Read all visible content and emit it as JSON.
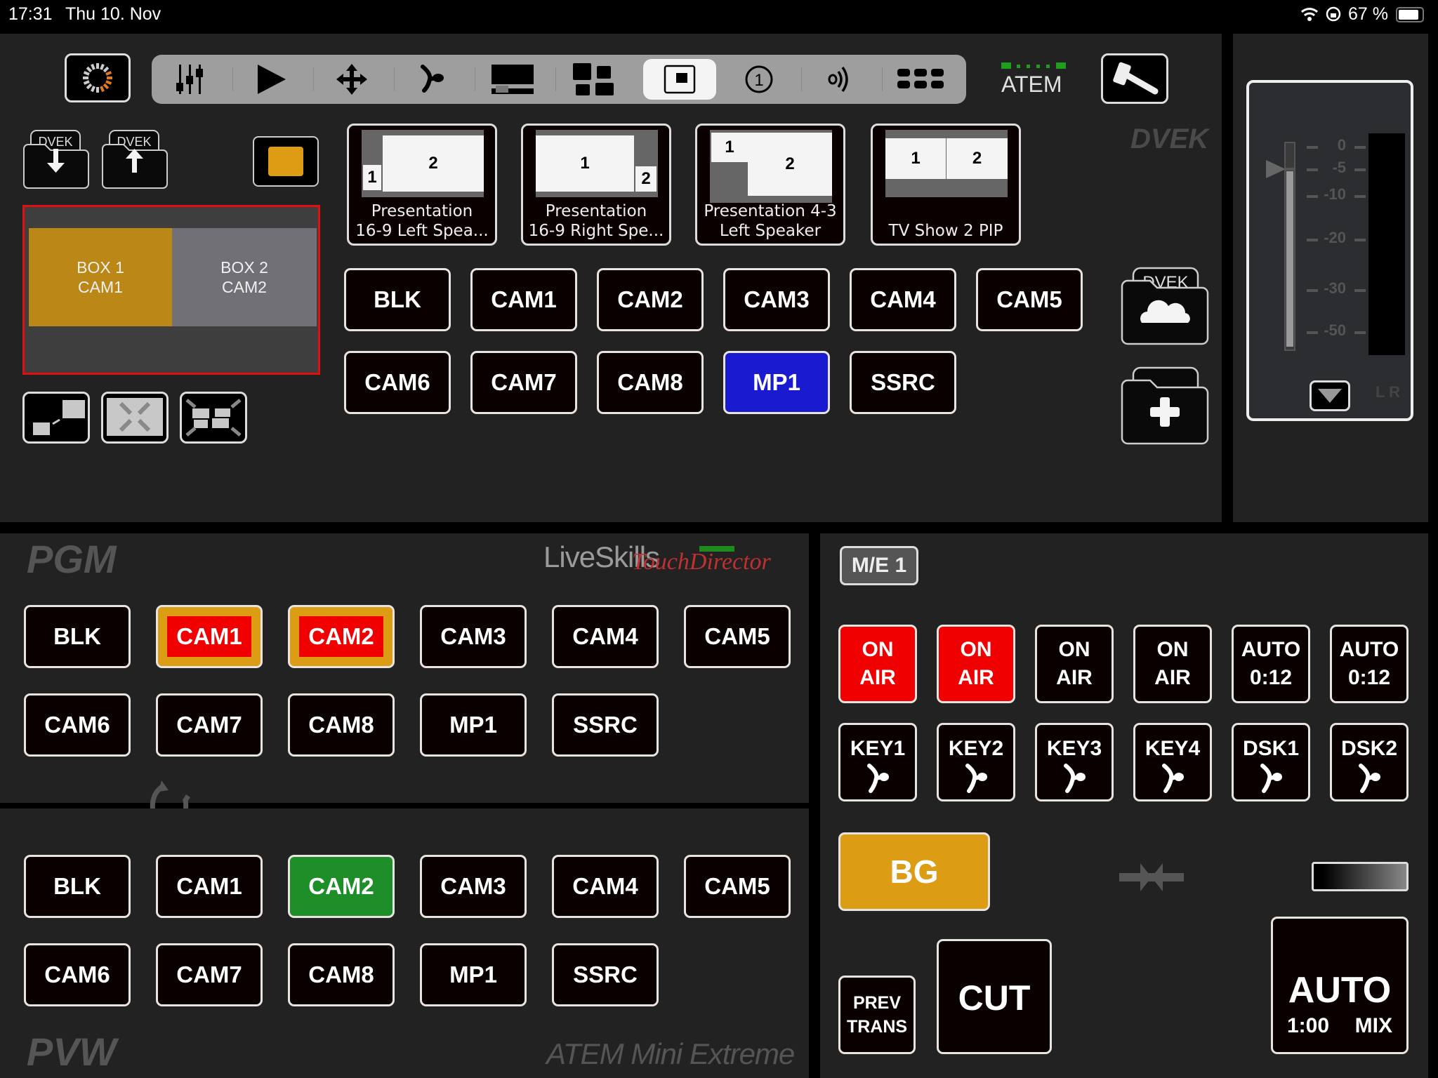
{
  "status_bar": {
    "time": "17:31",
    "date": "Thu 10. Nov",
    "battery": "67 %"
  },
  "toolbar": {
    "items": [
      "mixer-icon",
      "play-icon",
      "move-icon",
      "transition-icon",
      "lower-third-icon",
      "multiview-icon",
      "dvek-icon",
      "number-one-icon",
      "audio-icon",
      "more-icon"
    ],
    "active_index": 6
  },
  "atem": {
    "label": "ATEM",
    "connected_color": "#1e9e1e"
  },
  "dvek": {
    "title": "DVEK",
    "folder_tab_label": "DVEK",
    "box1": {
      "line1": "BOX 1",
      "line2": "CAM1",
      "color": "#bb8818"
    },
    "box2": {
      "line1": "BOX 2",
      "line2": "CAM2",
      "color": "#707076"
    },
    "color_swatch": "#dd9c14",
    "presets": [
      {
        "line1": "Presentation",
        "line2": "16-9 Left Spea...",
        "n1": "1",
        "n2": "2"
      },
      {
        "line1": "Presentation",
        "line2": "16-9 Right Spe...",
        "n1": "1",
        "n2": "2"
      },
      {
        "line1": "Presentation 4-3",
        "line2": "Left Speaker",
        "n1": "1",
        "n2": "2"
      },
      {
        "line1": "",
        "line2": "TV Show 2 PIP",
        "n1": "1",
        "n2": "2"
      }
    ],
    "sources": [
      "BLK",
      "CAM1",
      "CAM2",
      "CAM3",
      "CAM4",
      "CAM5",
      "CAM6",
      "CAM7",
      "CAM8",
      "MP1",
      "SSRC"
    ],
    "selected_source": "MP1",
    "selected_color": "#1a1ad0"
  },
  "audio": {
    "scale": [
      "0",
      "-5",
      "-10",
      "-20",
      "-30",
      "-50"
    ],
    "fader_db": -5,
    "channels": "L R"
  },
  "pgm": {
    "title": "PGM",
    "brand1": "LiveSkills",
    "brand2": "TouchDirector",
    "sources": [
      "BLK",
      "CAM1",
      "CAM2",
      "CAM3",
      "CAM4",
      "CAM5",
      "CAM6",
      "CAM7",
      "CAM8",
      "MP1",
      "SSRC"
    ],
    "on_air": [
      "CAM1",
      "CAM2"
    ]
  },
  "pvw": {
    "title": "PVW",
    "model": "ATEM Mini Extreme",
    "sources": [
      "BLK",
      "CAM1",
      "CAM2",
      "CAM3",
      "CAM4",
      "CAM5",
      "CAM6",
      "CAM7",
      "CAM8",
      "MP1",
      "SSRC"
    ],
    "selected": "CAM2"
  },
  "me": {
    "label": "M/E 1",
    "onair": [
      {
        "l1": "ON",
        "l2": "AIR",
        "active": true
      },
      {
        "l1": "ON",
        "l2": "AIR",
        "active": true
      },
      {
        "l1": "ON",
        "l2": "AIR",
        "active": false
      },
      {
        "l1": "ON",
        "l2": "AIR",
        "active": false
      },
      {
        "l1": "AUTO",
        "l2": "0:12",
        "active": false
      },
      {
        "l1": "AUTO",
        "l2": "0:12",
        "active": false
      }
    ],
    "keys": [
      "KEY1",
      "KEY2",
      "KEY3",
      "KEY4",
      "DSK1",
      "DSK2"
    ],
    "bg": "BG",
    "prev_trans": {
      "l1": "PREV",
      "l2": "TRANS"
    },
    "cut": "CUT",
    "auto": {
      "label": "AUTO",
      "rate": "1:00",
      "type": "MIX"
    }
  }
}
